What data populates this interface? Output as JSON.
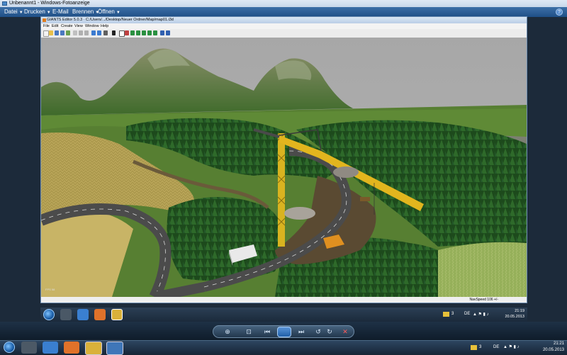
{
  "viewer": {
    "title": "Unbenannt1 - Windows-Fotoanzeige",
    "menu": [
      "Datei",
      "Drucken",
      "E-Mail",
      "Brennen",
      "Öffnen"
    ]
  },
  "editor": {
    "title": "GIANTS Editor 5.0.3 · C:/Users/.../Desktop/Neuer Ordner/Map/map01.i3d",
    "menu": [
      "File",
      "Edit",
      "Create",
      "View",
      "Window",
      "Help"
    ],
    "status_nav": "NavSpeed 106 +/-"
  },
  "inner_taskbar": {
    "tray_lang": "DE",
    "time": "21:19",
    "date": "20.05.2013",
    "mail_count": "3"
  },
  "taskbar": {
    "tray_lang": "DE",
    "time": "21:21",
    "date": "20.05.2013",
    "mail_count": "3"
  },
  "controls": {
    "icons": [
      "zoom-icon",
      "fit-icon",
      "previous-icon",
      "slideshow-icon",
      "next-icon",
      "rotate-left-icon",
      "rotate-right-icon",
      "delete-icon"
    ]
  },
  "colors": {
    "accent": "#1f4f86",
    "crane": "#e2b51e",
    "grass": "#4f7a2a",
    "field": "#c9a969",
    "sky": "#a9a9a9"
  }
}
